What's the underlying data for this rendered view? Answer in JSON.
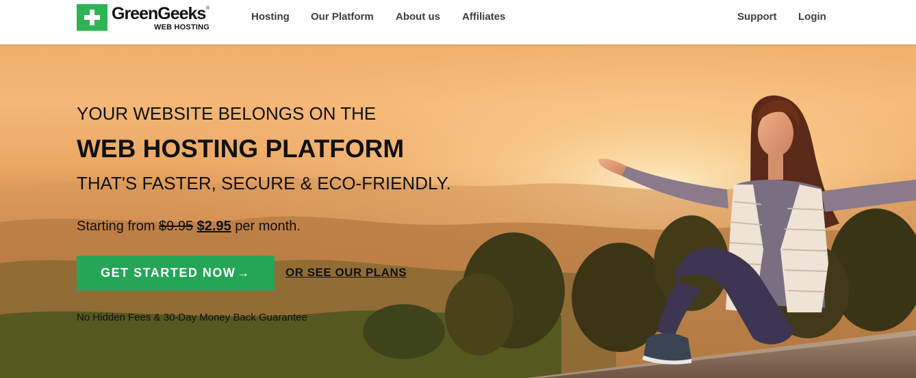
{
  "brand": {
    "name": "GreenGeeks",
    "registered": "®",
    "subtitle": "WEB HOSTING",
    "brand_color": "#2eb355"
  },
  "nav": {
    "items": [
      {
        "label": "Hosting"
      },
      {
        "label": "Our Platform"
      },
      {
        "label": "About us"
      },
      {
        "label": "Affiliates"
      }
    ],
    "right": [
      {
        "label": "Support"
      },
      {
        "label": "Login"
      }
    ]
  },
  "hero": {
    "line1": "YOUR WEBSITE BELONGS ON THE",
    "line2": "WEB HOSTING PLATFORM",
    "line3": "THAT'S FASTER, SECURE & ECO-FRIENDLY.",
    "price_prefix": "Starting from",
    "price_old": "$9.95",
    "price_new": "$2.95",
    "price_suffix": "per month.",
    "cta_label": "GET STARTED NOW",
    "cta_arrow": "→",
    "cta_color": "#24a656",
    "plans_link": "OR SEE OUR PLANS",
    "guarantee": "No Hidden Fees & 30-Day Money Back Guarantee",
    "image_icon": "woman-sunset-landscape-photo"
  }
}
